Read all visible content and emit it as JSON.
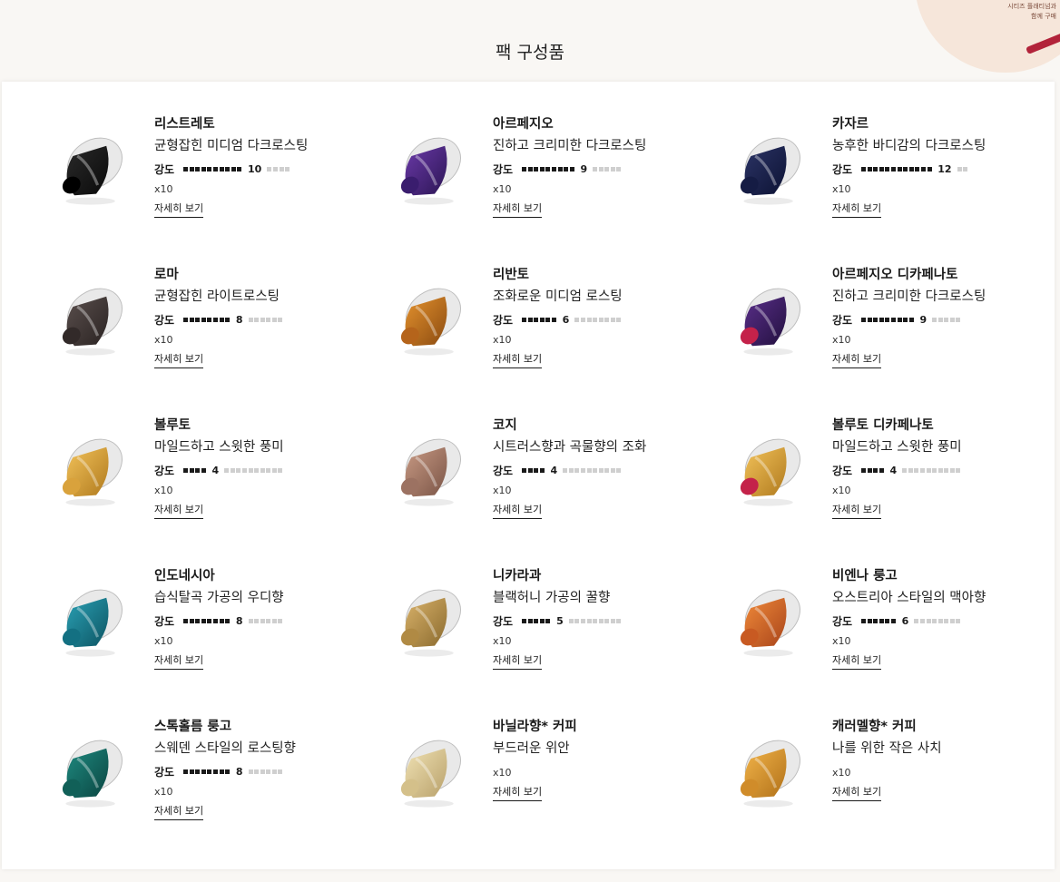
{
  "page": {
    "title": "팩 구성품",
    "corner_text_1": "시티즈 플래티넘과",
    "corner_text_2": "함께 구매"
  },
  "labels": {
    "intensity": "강도",
    "more": "자세히 보기",
    "qty": "x10"
  },
  "products": [
    {
      "name": "리스트레토",
      "desc": "균형잡힌 미디엄 다크로스팅",
      "intensity": 10,
      "color_top": "#2a2a2a",
      "color_bottom": "#0a0a0a",
      "base": "#000000"
    },
    {
      "name": "아르페지오",
      "desc": "진하고 크리미한 다크로스팅",
      "intensity": 9,
      "color_top": "#6b3aa8",
      "color_bottom": "#2b1554",
      "base": "#3a1d6e"
    },
    {
      "name": "카자르",
      "desc": "농후한 바디감의 다크로스팅",
      "intensity": 12,
      "color_top": "#2c3466",
      "color_bottom": "#0c1233",
      "base": "#151c44"
    },
    {
      "name": "로마",
      "desc": "균형잡힌 라이트로스팅",
      "intensity": 8,
      "color_top": "#5a4f4d",
      "color_bottom": "#2a2322",
      "base": "#322a29"
    },
    {
      "name": "리반토",
      "desc": "조화로운 미디엄 로스팅",
      "intensity": 6,
      "color_top": "#e4922e",
      "color_bottom": "#8a4a10",
      "base": "#b5641b"
    },
    {
      "name": "아르페지오 디카페나토",
      "desc": "진하고 크리미한 다크로스팅",
      "intensity": 9,
      "color_top": "#5a2f8a",
      "color_bottom": "#22103e",
      "base": "#c4224a"
    },
    {
      "name": "볼루토",
      "desc": "마일드하고 스윗한 풍미",
      "intensity": 4,
      "color_top": "#f2c25a",
      "color_bottom": "#b07a1e",
      "base": "#d9a23c"
    },
    {
      "name": "코지",
      "desc": "시트러스향과 곡물향의 조화",
      "intensity": 4,
      "color_top": "#c89a84",
      "color_bottom": "#7a5446",
      "base": "#9c7262"
    },
    {
      "name": "볼루토 디카페나토",
      "desc": "마일드하고 스윗한 풍미",
      "intensity": 4,
      "color_top": "#f2c25a",
      "color_bottom": "#b07a1e",
      "base": "#c4224a"
    },
    {
      "name": "인도네시아",
      "desc": "습식탈곡 가공의 우디향",
      "intensity": 8,
      "color_top": "#2aa0b4",
      "color_bottom": "#0d5462",
      "base": "#137082"
    },
    {
      "name": "니카라과",
      "desc": "블랙허니 가공의 꿀향",
      "intensity": 5,
      "color_top": "#d9b26a",
      "color_bottom": "#8a6a2e",
      "base": "#b08a44"
    },
    {
      "name": "비엔나 룽고",
      "desc": "오스트리아 스타일의 맥아향",
      "intensity": 6,
      "color_top": "#f08a3a",
      "color_bottom": "#a8441a",
      "base": "#c85a22"
    },
    {
      "name": "스톡홀름 룽고",
      "desc": "스웨덴 스타일의 로스팅향",
      "intensity": 8,
      "color_top": "#1f8a80",
      "color_bottom": "#0a4440",
      "base": "#116058"
    },
    {
      "name": "바닐라향* 커피",
      "desc": "부드러운 위안",
      "intensity": null,
      "color_top": "#f0e2b4",
      "color_bottom": "#b8a06a",
      "base": "#d4c08a"
    },
    {
      "name": "캐러멜향* 커피",
      "desc": "나를 위한 작은 사치",
      "intensity": null,
      "color_top": "#f2b44a",
      "color_bottom": "#b07018",
      "base": "#d08c2a"
    }
  ]
}
